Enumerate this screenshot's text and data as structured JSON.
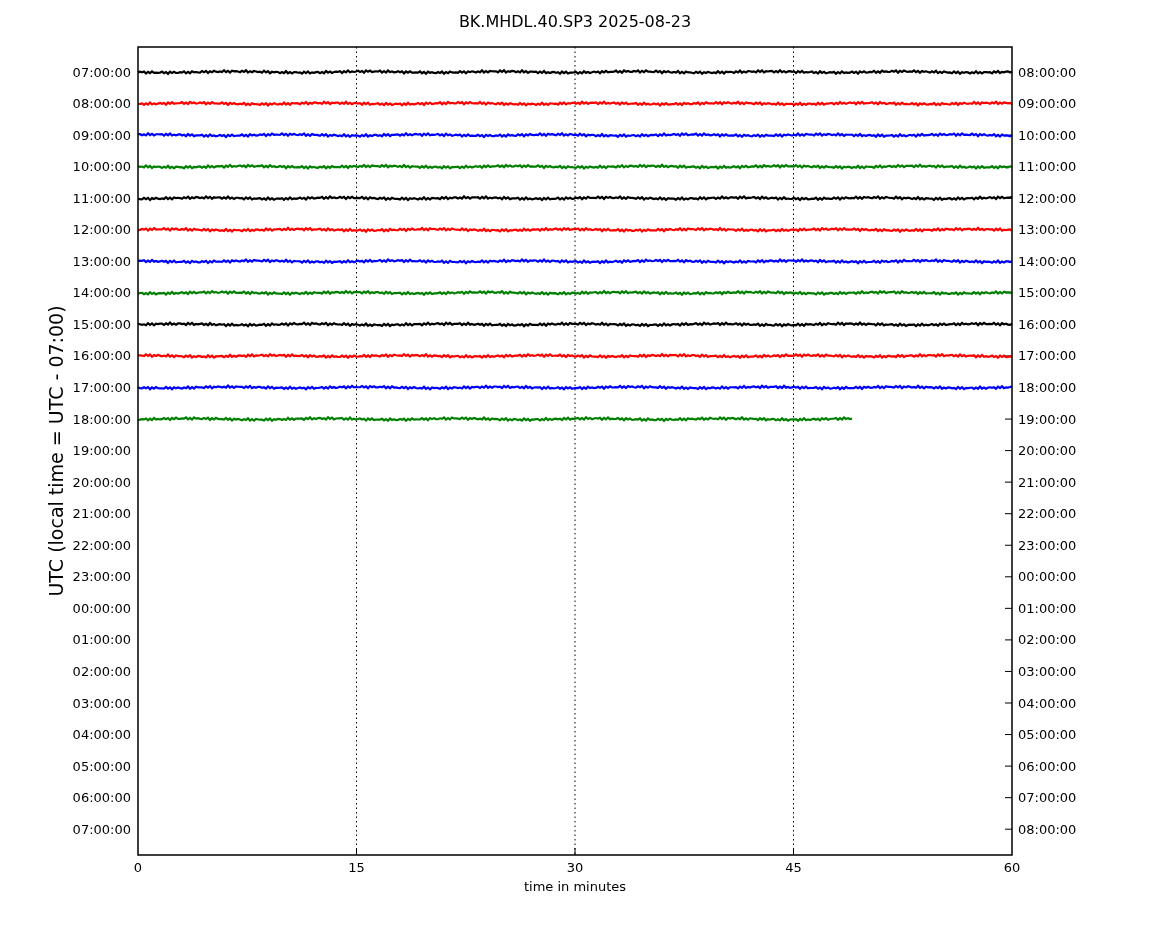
{
  "title": "BK.MHDL.40.SP3 2025-08-23",
  "ylabel": "UTC (local time = UTC - 07:00)",
  "xlabel": "time in minutes",
  "xticks": [
    "0",
    "15",
    "30",
    "45",
    "60"
  ],
  "left_ticks": [
    "07:00:00",
    "08:00:00",
    "09:00:00",
    "10:00:00",
    "11:00:00",
    "12:00:00",
    "13:00:00",
    "14:00:00",
    "15:00:00",
    "16:00:00",
    "17:00:00",
    "18:00:00",
    "19:00:00",
    "20:00:00",
    "21:00:00",
    "22:00:00",
    "23:00:00",
    "00:00:00",
    "01:00:00",
    "02:00:00",
    "03:00:00",
    "04:00:00",
    "05:00:00",
    "06:00:00",
    "07:00:00"
  ],
  "right_ticks": [
    "08:00:00",
    "09:00:00",
    "10:00:00",
    "11:00:00",
    "12:00:00",
    "13:00:00",
    "14:00:00",
    "15:00:00",
    "16:00:00",
    "17:00:00",
    "18:00:00",
    "19:00:00",
    "20:00:00",
    "21:00:00",
    "22:00:00",
    "23:00:00",
    "00:00:00",
    "01:00:00",
    "02:00:00",
    "03:00:00",
    "04:00:00",
    "05:00:00",
    "06:00:00",
    "07:00:00",
    "08:00:00"
  ],
  "traces": [
    {
      "color": "#000000",
      "level": 1
    },
    {
      "color": "#ff0000",
      "level": 1
    },
    {
      "color": "#0000ff",
      "level": 1
    },
    {
      "color": "#008000",
      "level": 1
    },
    {
      "color": "#000000",
      "level": 1
    },
    {
      "color": "#ff0000",
      "level": 1
    },
    {
      "color": "#0000ff",
      "level": 1
    },
    {
      "color": "#008000",
      "level": 1
    },
    {
      "color": "#000000",
      "level": 1
    },
    {
      "color": "#ff0000",
      "level": 1
    },
    {
      "color": "#0000ff",
      "level": 1
    },
    {
      "color": "#008000",
      "level": 0.817
    }
  ]
}
